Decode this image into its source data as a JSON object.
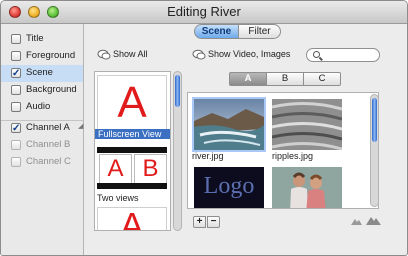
{
  "window": {
    "title": "Editing River"
  },
  "sidebar": {
    "items": [
      {
        "label": "Title",
        "checked": false
      },
      {
        "label": "Foreground",
        "checked": false
      },
      {
        "label": "Scene",
        "checked": true,
        "selected": true
      },
      {
        "label": "Background",
        "checked": false
      },
      {
        "label": "Audio",
        "checked": false
      }
    ],
    "channels": [
      {
        "label": "Channel A",
        "checked": true
      },
      {
        "label": "Channel B",
        "checked": false,
        "disabled": true
      },
      {
        "label": "Channel C",
        "checked": false,
        "disabled": true
      }
    ]
  },
  "mode_tabs": [
    {
      "label": "Scene",
      "selected": true
    },
    {
      "label": "Filter",
      "selected": false
    }
  ],
  "left_header": {
    "label": "Show All"
  },
  "right_header": {
    "label": "Show Video, Images"
  },
  "search": {
    "placeholder": ""
  },
  "layouts": [
    {
      "label": "Fullscreen View",
      "glyph": "A",
      "selected": true
    },
    {
      "label": "Two views",
      "glyphs": [
        "A",
        "B"
      ]
    },
    {
      "glyph": "A"
    }
  ],
  "channel_tabs": [
    {
      "label": "A",
      "selected": true
    },
    {
      "label": "B",
      "selected": false
    },
    {
      "label": "C",
      "selected": false
    }
  ],
  "media": [
    {
      "label": "river.jpg",
      "selected": true
    },
    {
      "label": "ripples.jpg",
      "selected": false
    },
    {
      "caption": "Logo"
    },
    {
      "caption": ""
    }
  ],
  "toolbar": {
    "add_label": "+",
    "remove_label": "−"
  },
  "colors": {
    "accent": "#3a6fc2",
    "selection_bg": "#c7dcf5",
    "layout_letter": "#e11b1b"
  }
}
